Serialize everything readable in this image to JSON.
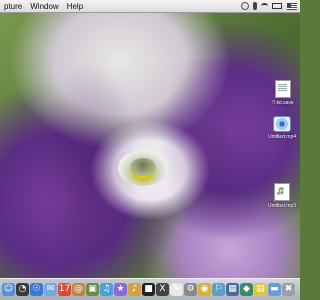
{
  "menubar": {
    "items": [
      "pture",
      "Window",
      "Help"
    ]
  },
  "desktop": {
    "icons": [
      {
        "label": "!!.txt.save",
        "type": "document"
      },
      {
        "label": "Untitled.mp4",
        "type": "disc"
      },
      {
        "label": "Untitled.mp3",
        "type": "audio"
      }
    ]
  },
  "dock": {
    "icons": [
      {
        "name": "finder-icon",
        "glyph": "☺",
        "color": "#5a8fd6"
      },
      {
        "name": "dashboard-icon",
        "glyph": "◔",
        "color": "#3a3a3a"
      },
      {
        "name": "safari-icon",
        "glyph": "☉",
        "color": "#3b7bd6"
      },
      {
        "name": "mail-icon",
        "glyph": "✉",
        "color": "#7aa6d8"
      },
      {
        "name": "ical-icon",
        "glyph": "17",
        "color": "#d84a3a"
      },
      {
        "name": "address-book-icon",
        "glyph": "@",
        "color": "#b8884a"
      },
      {
        "name": "photo-icon",
        "glyph": "▣",
        "color": "#6a8a4a"
      },
      {
        "name": "itunes-icon",
        "glyph": "♫",
        "color": "#4aa0d8"
      },
      {
        "name": "imovie-icon",
        "glyph": "★",
        "color": "#8a6ad8"
      },
      {
        "name": "garageband-icon",
        "glyph": "♪",
        "color": "#d8a040"
      },
      {
        "name": "terminal-icon",
        "glyph": "■",
        "color": "#222222"
      },
      {
        "name": "x11-icon",
        "glyph": "X",
        "color": "#444444"
      },
      {
        "name": "textedit-icon",
        "glyph": "✎",
        "color": "#e8e8e8"
      },
      {
        "name": "system-prefs-icon",
        "glyph": "⚙",
        "color": "#8a8a8a"
      },
      {
        "name": "chrome-icon",
        "glyph": "◉",
        "color": "#d8b03a"
      },
      {
        "name": "preview-icon",
        "glyph": "⚐",
        "color": "#5aa0c8"
      },
      {
        "name": "spaces-icon",
        "glyph": "▦",
        "color": "#4a6a9a"
      },
      {
        "name": "network-icon",
        "glyph": "◆",
        "color": "#3a8a6a"
      },
      {
        "name": "stickies-icon",
        "glyph": "▤",
        "color": "#d8c83a"
      },
      {
        "name": "folder-icon",
        "glyph": "▬",
        "color": "#6a9ad8"
      },
      {
        "name": "trash-icon",
        "glyph": "✖",
        "color": "#9aa0a8"
      }
    ]
  }
}
